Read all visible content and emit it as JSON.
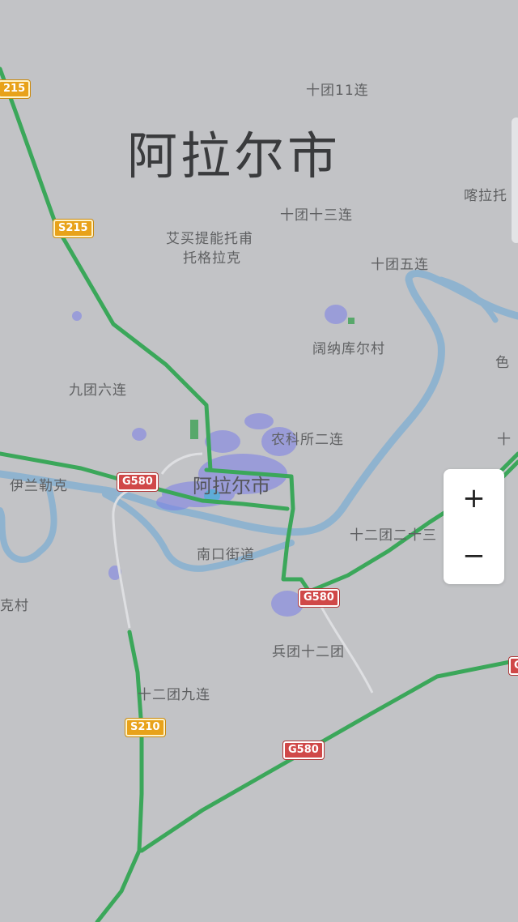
{
  "map": {
    "region_title": "阿拉尔市",
    "city_label": "阿拉尔市",
    "places": {
      "shituan_11": "十团11连",
      "kalatuo": "喀拉托",
      "shituan_13": "十团十三连",
      "aimai_1": "艾买提能托甫",
      "aimai_2": "托格拉克",
      "shituan_5": "十团五连",
      "kuona": "阔纳库尔村",
      "se": "色",
      "jiutuan_6": "九团六连",
      "nongke": "农科所二连",
      "shi_right": "十",
      "yilan": "伊兰勒克",
      "shiertuan_2": "十二团二十三",
      "nankou": "南口街道",
      "cun_left": "克村",
      "bingtuan_12": "兵团十二团",
      "shiertuan_9": "十二团九连"
    },
    "route_shields": {
      "s215_top": "215",
      "s215": "S215",
      "g580_a": "G580",
      "g580_b": "G580",
      "g580_c": "G580",
      "g580_edge": "G",
      "s210": "S210"
    },
    "colors": {
      "background": "#c2c3c6",
      "road_green": "#3ba75a",
      "river": "#8fb3cf",
      "heat": "#7a7ee8"
    }
  },
  "zoom_controls": {
    "zoom_in": "+",
    "zoom_out": "−"
  }
}
